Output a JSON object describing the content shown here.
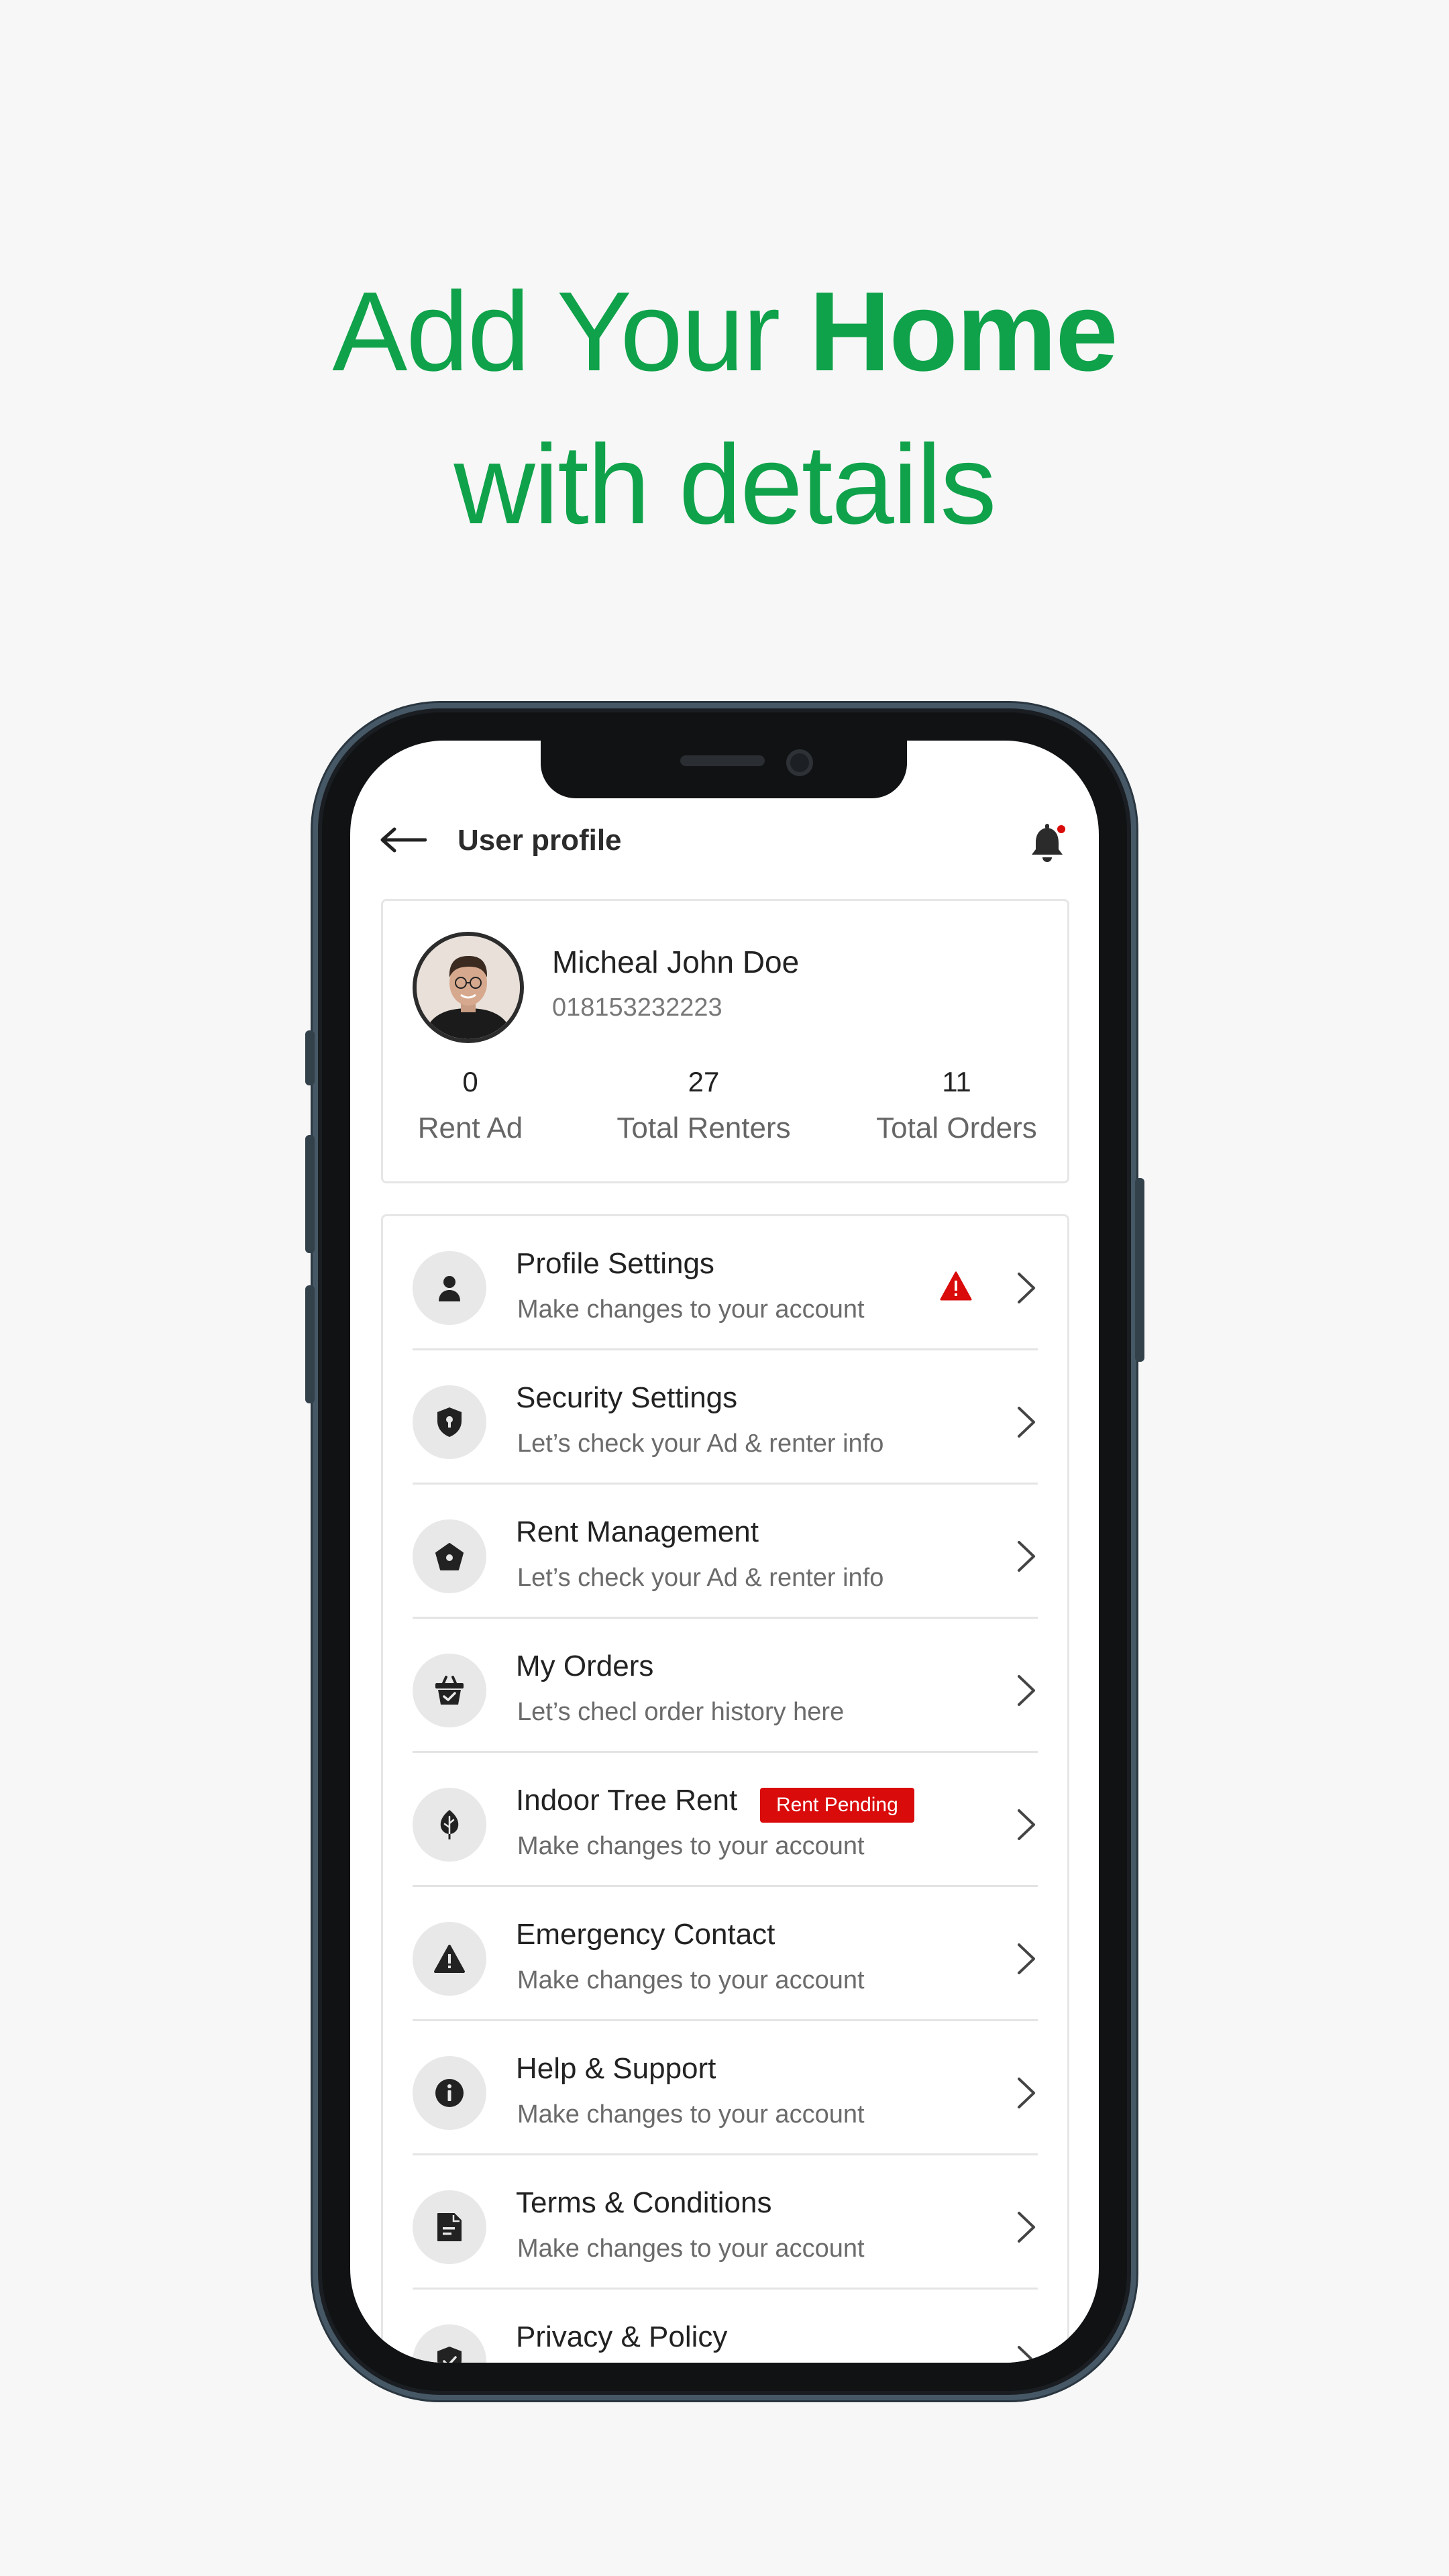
{
  "headline": {
    "part1": "Add Your",
    "bold": "Home",
    "line2": "with details"
  },
  "header": {
    "title": "User profile"
  },
  "profile": {
    "name": "Micheal John Doe",
    "phone": "018153232223",
    "stats": [
      {
        "value": "0",
        "label": "Rent Ad"
      },
      {
        "value": "27",
        "label": "Total Renters"
      },
      {
        "value": "11",
        "label": "Total Orders"
      }
    ]
  },
  "menu": {
    "items": [
      {
        "title": "Profile Settings",
        "subtitle": "Make changes to your account",
        "icon": "user-icon"
      },
      {
        "title": "Security Settings",
        "subtitle": "Let’s check your Ad & renter info",
        "icon": "shield-icon"
      },
      {
        "title": "Rent Management",
        "subtitle": "Let’s check your Ad & renter info",
        "icon": "house-icon"
      },
      {
        "title": "My Orders",
        "subtitle": "Let’s checl order history here",
        "icon": "basket-icon"
      },
      {
        "title": "Indoor Tree Rent",
        "subtitle": "Make changes to your account",
        "icon": "leaf-icon",
        "badge": "Rent Pending"
      },
      {
        "title": "Emergency Contact",
        "subtitle": "Make changes to your account",
        "icon": "alert-icon"
      },
      {
        "title": "Help & Support",
        "subtitle": "Make changes to your account",
        "icon": "info-icon"
      },
      {
        "title": "Terms & Conditions",
        "subtitle": "Make changes to your account",
        "icon": "document-icon"
      },
      {
        "title": "Privacy & Policy",
        "subtitle": "",
        "icon": "shield-check-icon"
      }
    ]
  },
  "colors": {
    "brand_green": "#0fa24a",
    "alert_red": "#d90b0b"
  }
}
